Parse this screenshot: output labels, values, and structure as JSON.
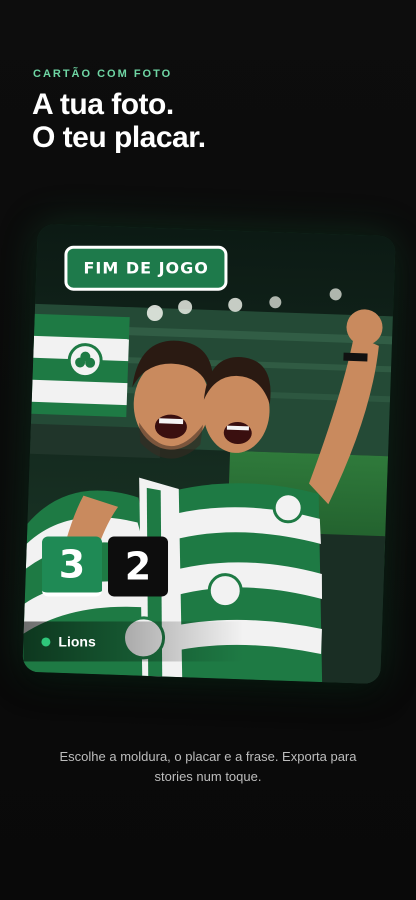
{
  "intro": {
    "eyebrow": "CARTÃO COM FOTO",
    "headline_line1": "A tua foto.",
    "headline_line2": "O teu placar."
  },
  "card": {
    "status_badge": "FIM DE JOGO",
    "score_home": "3",
    "score_away": "2",
    "team_name": "Lions",
    "photo": "celebrating-fans-stadium-photo"
  },
  "caption": "Escolhe a moldura, o placar e a frase. Exporta para stories num toque.",
  "colors": {
    "accent": "#6fd6a4",
    "brand_green": "#1f8a55",
    "background": "#0b0b0b"
  }
}
